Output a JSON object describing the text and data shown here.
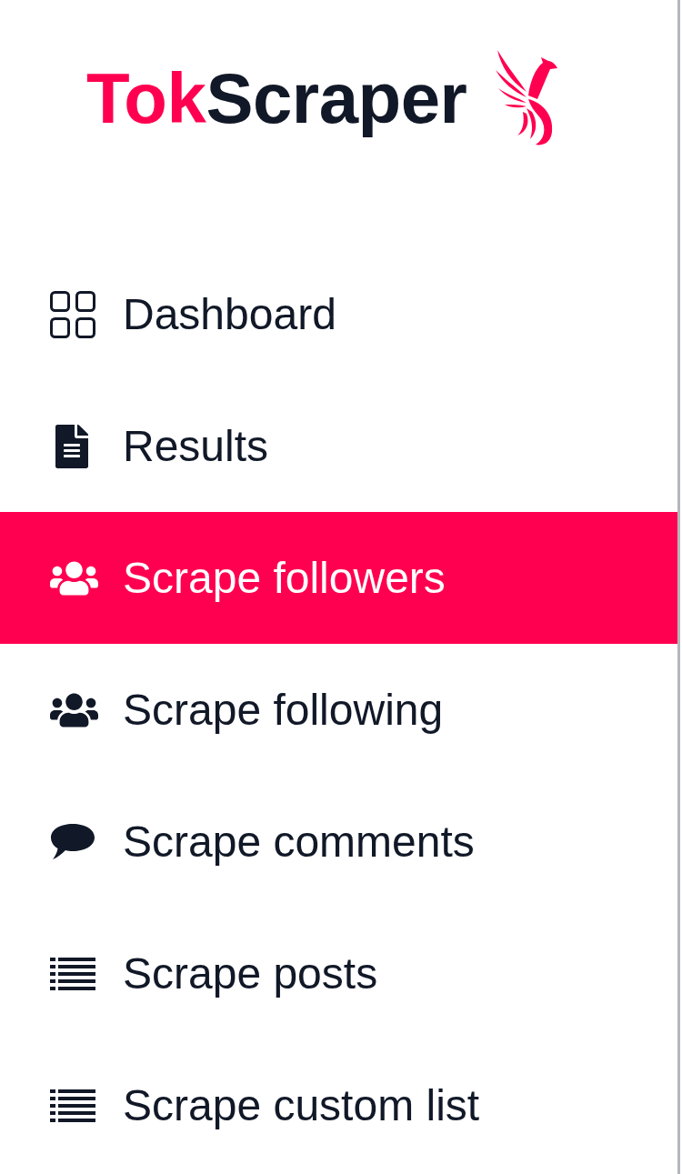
{
  "logo": {
    "prefix": "Tok",
    "name": "Scraper"
  },
  "sidebar": {
    "items": [
      {
        "label": "Dashboard",
        "kind": "grid",
        "selected": false
      },
      {
        "label": "Results",
        "kind": "document",
        "selected": false
      },
      {
        "label": "Scrape followers",
        "kind": "users",
        "selected": true
      },
      {
        "label": "Scrape following",
        "kind": "users",
        "selected": false
      },
      {
        "label": "Scrape comments",
        "kind": "comment",
        "selected": false
      },
      {
        "label": "Scrape posts",
        "kind": "list",
        "selected": false
      },
      {
        "label": "Scrape custom list",
        "kind": "list",
        "selected": false
      }
    ]
  }
}
